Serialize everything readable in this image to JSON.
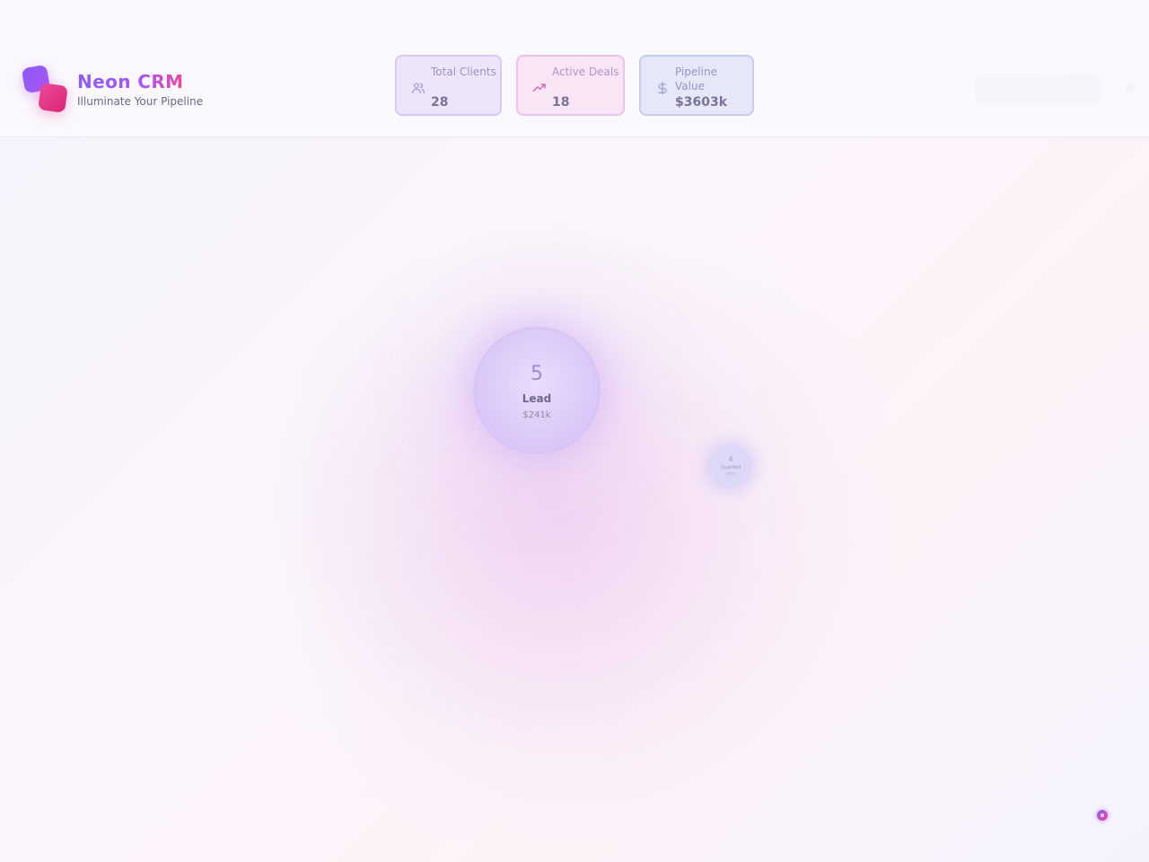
{
  "app": {
    "title": "Neon CRM",
    "tagline": "Illuminate Your Pipeline"
  },
  "stats": [
    {
      "label": "Total Clients",
      "value": "28",
      "icon": "users-icon",
      "color": "#8b5cf6"
    },
    {
      "label": "Active Deals",
      "value": "18",
      "icon": "trending-up-icon",
      "color": "#ec4899"
    },
    {
      "label": "Pipeline Value",
      "value": "$3603k",
      "icon": "dollar-icon",
      "color": "#6366f1"
    }
  ],
  "stages": {
    "lead": {
      "count": "5",
      "name": "Lead",
      "amount": "$241k"
    },
    "small": {
      "count": "4",
      "name": "Qualified",
      "amount": "$80k"
    }
  },
  "colors": {
    "brand_purple": "#8b5cf6",
    "brand_pink": "#ec4899",
    "brand_indigo": "#6366f1"
  }
}
